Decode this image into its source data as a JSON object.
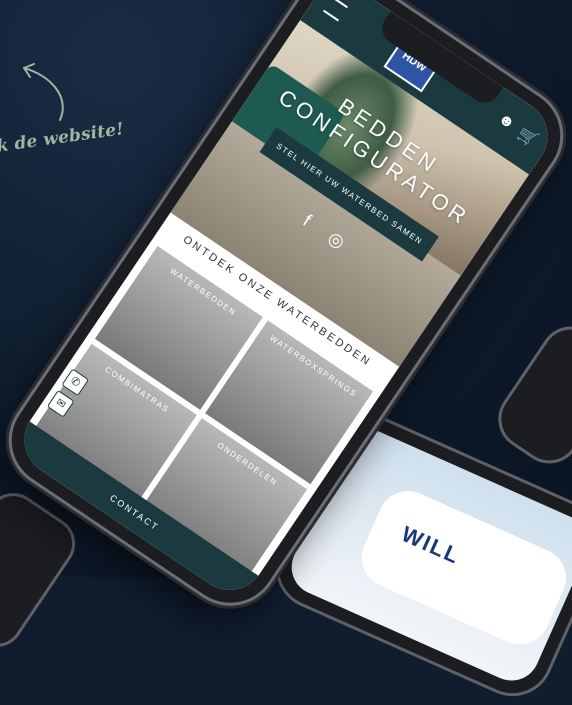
{
  "background_text": "k de website!",
  "phone": {
    "logo": "HDW",
    "hero": {
      "title_line1": "BEDDEN",
      "title_line2": "CONFIGURATOR",
      "cta": "STEL HIER UW WATERBED SAMEN"
    },
    "social": {
      "facebook_glyph": "f",
      "instagram_glyph": "◎"
    },
    "section_title": "ONTDEK ONZE WATERBEDDEN",
    "tiles": [
      {
        "label": "WATERBEDDEN"
      },
      {
        "label": "WATERBOXSPRINGS"
      },
      {
        "label": "COMBIMATRAS"
      },
      {
        "label": "ONDERDELEN"
      }
    ],
    "contact": "CONTACT",
    "icons": {
      "menu": "menu-icon",
      "user": "user-icon",
      "cart": "cart-icon",
      "whatsapp": "whatsapp-icon",
      "mail": "mail-icon"
    }
  },
  "device3": {
    "text": "WILL"
  },
  "colors": {
    "background": "#0f1d2f",
    "brand": "#1b3a3f",
    "handwriting": "#9fb7a2"
  }
}
